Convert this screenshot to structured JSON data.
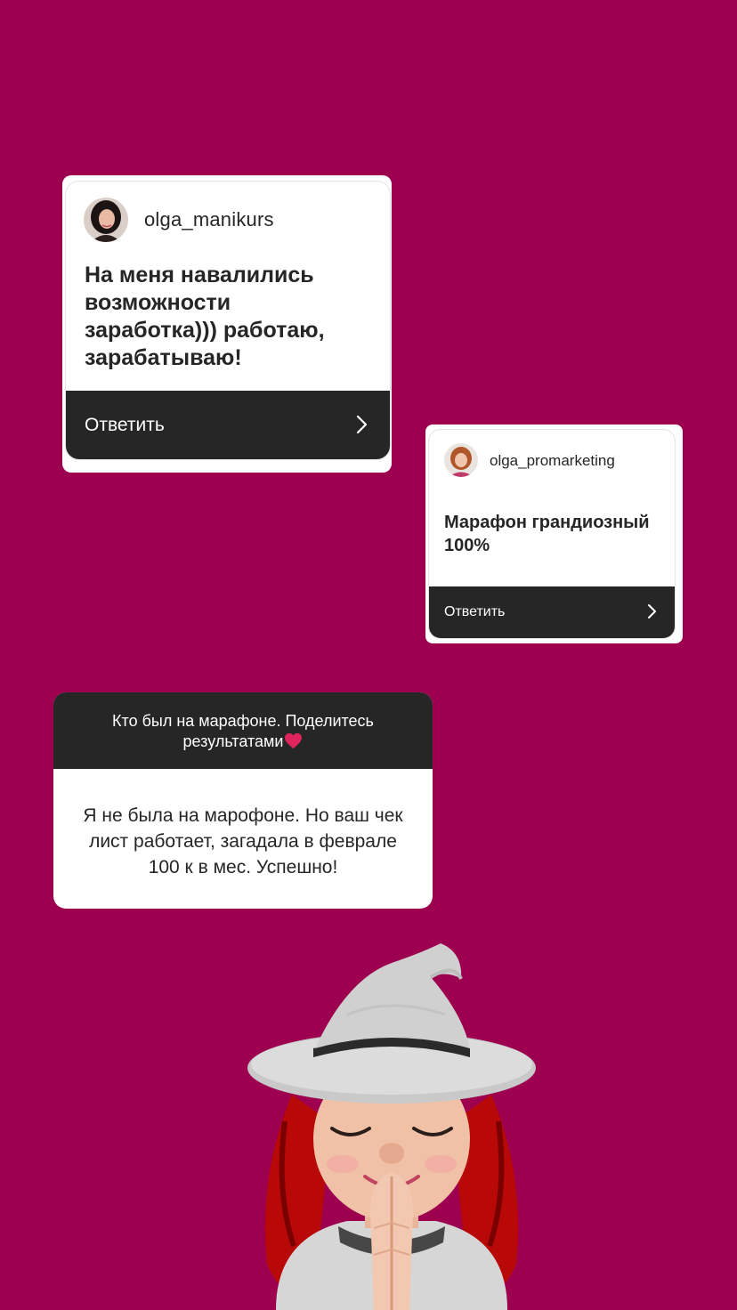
{
  "replies": [
    {
      "username": "olga_manikurs",
      "avatar_icon": "profile-photo-icon",
      "message": "На меня навалились возможности заработка))) работаю, зарабатываю!",
      "reply_label": "Ответить",
      "chevron_icon": "chevron-right-icon"
    },
    {
      "username": "olga_promarketing",
      "avatar_icon": "profile-photo-icon",
      "message": "Марафон грандиозный 100%",
      "reply_label": "Ответить",
      "chevron_icon": "chevron-right-icon"
    }
  ],
  "question_sticker": {
    "question": "Кто был на марафоне. Поделитесь результатами",
    "question_emoji": "heart-icon",
    "answer": "Я не была на марофоне. Но ваш чек лист работает, загадала в феврале 100 к в мес. Успешно!"
  },
  "sticker": {
    "icon": "memoji-witch-praying-icon"
  },
  "colors": {
    "background": "#9c004f",
    "card": "#ffffff",
    "bar": "#262626",
    "text_dark": "#262626",
    "text_light": "#ffffff",
    "heart": "#e0245e"
  }
}
